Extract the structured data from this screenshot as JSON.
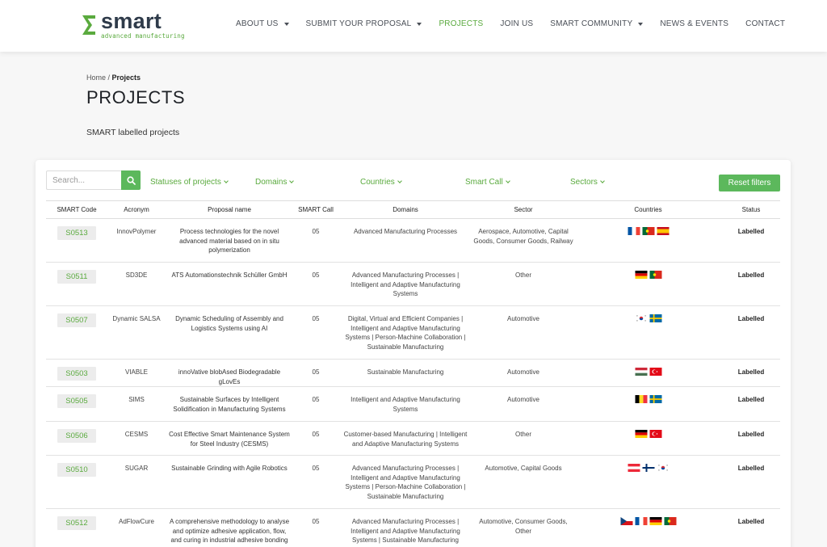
{
  "brand": {
    "name": "smart",
    "tagline": "advanced manufacturing",
    "accent": "#5aaa3e",
    "button_green": "#5cb85c"
  },
  "nav": [
    {
      "label": "ABOUT US",
      "dropdown": true,
      "active": false
    },
    {
      "label": "SUBMIT YOUR PROPOSAL",
      "dropdown": true,
      "active": false
    },
    {
      "label": "PROJECTS",
      "dropdown": false,
      "active": true
    },
    {
      "label": "JOIN US",
      "dropdown": false,
      "active": false
    },
    {
      "label": "SMART COMMUNITY",
      "dropdown": true,
      "active": false
    },
    {
      "label": "NEWS & EVENTS",
      "dropdown": false,
      "active": false
    },
    {
      "label": "CONTACT",
      "dropdown": false,
      "active": false
    }
  ],
  "breadcrumb": {
    "home": "Home",
    "sep": " / ",
    "current": "Projects"
  },
  "page": {
    "title": "PROJECTS",
    "subtitle": "SMART labelled projects"
  },
  "search": {
    "placeholder": "Search...",
    "icon": "search-icon"
  },
  "filters": [
    "Statuses of projects",
    "Domains",
    "Countries",
    "Smart Call",
    "Sectors"
  ],
  "reset_label": "Reset filters",
  "table": {
    "headers": [
      "SMART Code",
      "Acronym",
      "Proposal name",
      "SMART Call",
      "Domains",
      "Sector",
      "Countries",
      "Status"
    ],
    "rows": [
      {
        "code": "S0513",
        "acronym": "InnovPolymer",
        "name": "Process technologies for the novel advanced material based on in situ polymerization",
        "call": "05",
        "domains": "Advanced Manufacturing Processes",
        "sector": "Aerospace, Automotive, Capital Goods, Consumer Goods, Railway",
        "countries": [
          "France",
          "Portugal",
          "Spain"
        ],
        "status": "Labelled"
      },
      {
        "code": "S0511",
        "acronym": "SD3DE",
        "name": "ATS Automationstechnik Schüller GmbH",
        "call": "05",
        "domains": "Advanced Manufacturing Processes | Intelligent and Adaptive Manufacturing Systems",
        "sector": "Other",
        "countries": [
          "Germany",
          "Portugal"
        ],
        "status": "Labelled"
      },
      {
        "code": "S0507",
        "acronym": "Dynamic SALSA",
        "name": "Dynamic Scheduling of Assembly and Logistics Systems using AI",
        "call": "05",
        "domains": "Digital, Virtual and Efficient Companies | Intelligent and Adaptive Manufacturing Systems | Person-Machine Collaboration | Sustainable Manufacturing",
        "sector": "Automotive",
        "countries": [
          "South Korea",
          "Sweden"
        ],
        "status": "Labelled"
      },
      {
        "code": "S0503",
        "acronym": "VIABLE",
        "name": "innoVative blobAsed Biodegradable gLovEs",
        "call": "05",
        "domains": "Sustainable Manufacturing",
        "sector": "Automotive",
        "countries": [
          "Hungary",
          "Turkey"
        ],
        "status": "Labelled"
      },
      {
        "code": "S0505",
        "acronym": "SIMS",
        "name": "Sustainable Surfaces by Intelligent Solidification in Manufacturing Systems",
        "call": "05",
        "domains": "Intelligent and Adaptive Manufacturing Systems",
        "sector": "Automotive",
        "countries": [
          "Belgium",
          "Sweden"
        ],
        "status": "Labelled"
      },
      {
        "code": "S0506",
        "acronym": "CESMS",
        "name": "Cost Effective Smart Maintenance System for Steel Industry (CESMS)",
        "call": "05",
        "domains": "Customer-based Manufacturing | Intelligent and Adaptive Manufacturing Systems",
        "sector": "Other",
        "countries": [
          "Germany",
          "Turkey"
        ],
        "status": "Labelled"
      },
      {
        "code": "S0510",
        "acronym": "SUGAR",
        "name": "Sustainable Grinding with Agile Robotics",
        "call": "05",
        "domains": "Advanced Manufacturing Processes | Intelligent and Adaptive Manufacturing Systems | Person-Machine Collaboration | Sustainable Manufacturing",
        "sector": "Automotive, Capital Goods",
        "countries": [
          "Austria",
          "Finland",
          "South Korea"
        ],
        "status": "Labelled"
      },
      {
        "code": "S0512",
        "acronym": "AdFlowCure",
        "name": "A comprehensive methodology to analyse and optimize adhesive application, flow, and curing in industrial adhesive bonding processes",
        "call": "05",
        "domains": "Advanced Manufacturing Processes | Intelligent and Adaptive Manufacturing Systems | Sustainable Manufacturing",
        "sector": "Automotive, Consumer Goods, Other",
        "countries": [
          "Czech Republic",
          "France",
          "Germany",
          "Portugal"
        ],
        "status": "Labelled"
      }
    ]
  }
}
